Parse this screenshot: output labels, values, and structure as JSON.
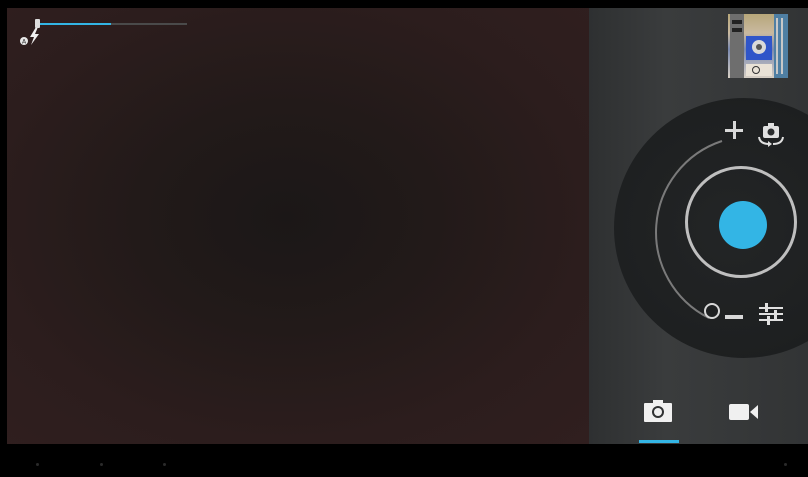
{
  "camera": {
    "flash_icon": "auto-flash-icon",
    "exposure": {
      "level": 0.5
    },
    "thumbnail_icon": "last-photo-thumbnail",
    "switch_camera_icon": "switch-camera-icon",
    "settings_icon": "settings-sliders-icon",
    "zoom_in_icon": "zoom-plus-icon",
    "zoom_out_icon": "zoom-minus-icon",
    "shutter_icon": "shutter-button",
    "active_mode": "photo",
    "modes": [
      {
        "name": "photo",
        "icon": "camera-icon"
      },
      {
        "name": "video",
        "icon": "video-camera-icon"
      }
    ]
  },
  "colors": {
    "accent": "#33b5e5",
    "viewfinder": "#2a1c1c",
    "panel": "#353738",
    "navbar": "#000000"
  }
}
